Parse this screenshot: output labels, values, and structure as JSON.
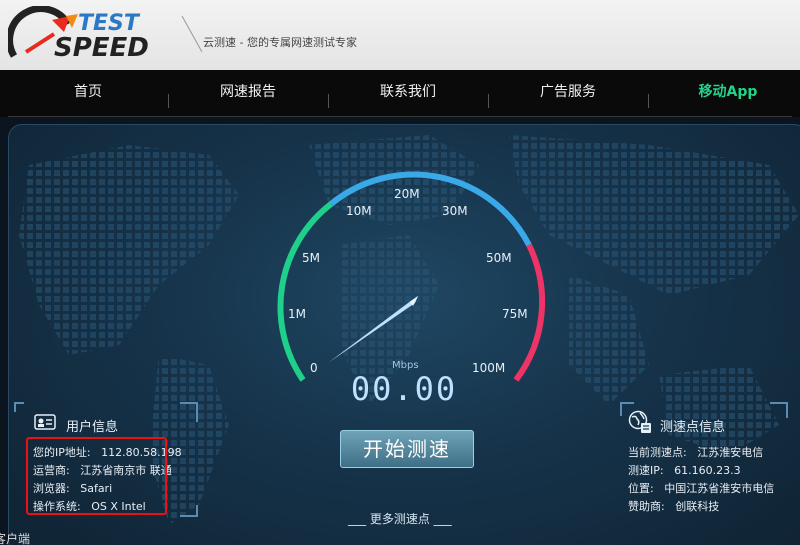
{
  "header": {
    "logo_top": "TEST",
    "logo_bottom": "SPEED",
    "tagline": "云测速 - 您的专属网速测试专家"
  },
  "nav": {
    "items": [
      {
        "label": "首页",
        "active": false
      },
      {
        "label": "网速报告",
        "active": false
      },
      {
        "label": "联系我们",
        "active": false
      },
      {
        "label": "广告服务",
        "active": false
      },
      {
        "label": "移动App",
        "active": true
      }
    ]
  },
  "gauge": {
    "ticks": [
      "0",
      "1M",
      "5M",
      "10M",
      "20M",
      "30M",
      "50M",
      "75M",
      "100M"
    ],
    "unit": "Mbps",
    "current_speed": "00.00",
    "colors": {
      "green": "#1fd08a",
      "blue": "#3aa9e8",
      "pink": "#ee3466",
      "needle": "#bfe0ff"
    }
  },
  "actions": {
    "start_label": "开始测速",
    "more_points": "___ 更多测速点 ___"
  },
  "user_info": {
    "title": "用户信息",
    "rows": [
      {
        "label": "您的IP地址:",
        "value": "112.80.58.198"
      },
      {
        "label": "运营商:",
        "value": "江苏省南京市 联通"
      },
      {
        "label": "浏览器:",
        "value": "Safari"
      },
      {
        "label": "操作系统:",
        "value": "OS X Intel"
      }
    ]
  },
  "server_info": {
    "title": "测速点信息",
    "rows": [
      {
        "label": "当前测速点:",
        "value": "江苏淮安电信"
      },
      {
        "label": "测速IP:",
        "value": "61.160.23.3"
      },
      {
        "label": "位置:",
        "value": "中国江苏省淮安市电信"
      },
      {
        "label": "赞助商:",
        "value": "创联科技"
      }
    ]
  },
  "footer": {
    "partial_text": "客户端"
  }
}
